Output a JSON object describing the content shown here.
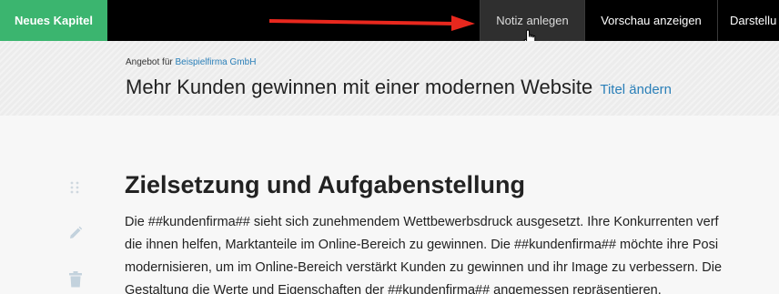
{
  "toolbar": {
    "new_chapter_label": "Neues Kapitel",
    "add_note_label": "Notiz anlegen",
    "preview_label": "Vorschau anzeigen",
    "display_label": "Darstellu"
  },
  "header": {
    "offer_prefix": "Angebot für",
    "company_name": "Beispielfirma GmbH",
    "title": "Mehr Kunden gewinnen mit einer modernen Website",
    "rename_link": "Titel ändern"
  },
  "section": {
    "heading": "Zielsetzung und Aufgabenstellung",
    "lines": [
      "Die ##kundenfirma## sieht sich zunehmendem Wettbewerbsdruck ausgesetzt. Ihre Konkurrenten verf",
      "die ihnen helfen, Marktanteile im Online-Bereich zu gewinnen. Die ##kundenfirma## möchte ihre Posi",
      "modernisieren, um im Online-Bereich verstärkt Kunden zu gewinnen und ihr Image zu verbessern. Die",
      "Gestaltung die Werte und Eigenschaften der ##kundenfirma## angemessen repräsentieren."
    ]
  },
  "colors": {
    "accent_green": "#3bb56f",
    "link_blue": "#2a7fb8",
    "arrow_red": "#e8281e"
  },
  "icons": [
    "drag-handle-icon",
    "pencil-icon",
    "trash-icon",
    "hand-cursor-icon",
    "arrow-icon"
  ]
}
